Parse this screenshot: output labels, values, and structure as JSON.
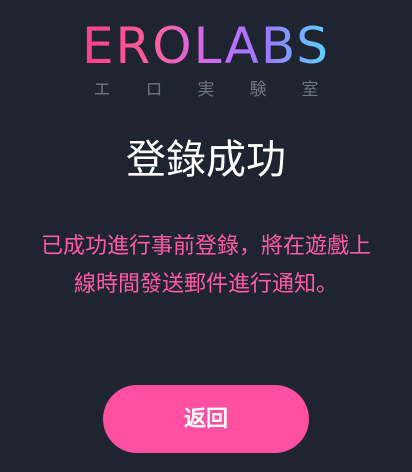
{
  "logo": {
    "word": "EROLABS",
    "sub_chars": [
      "エ",
      "ロ",
      "実",
      "験",
      "室"
    ]
  },
  "title": "登錄成功",
  "message": "已成功進行事前登錄，將在遊戲上線時間發送郵件進行通知。",
  "back_button_label": "返回",
  "colors": {
    "background": "#1e2530",
    "accent": "#ff4fa0",
    "message": "#ff5aa5"
  }
}
